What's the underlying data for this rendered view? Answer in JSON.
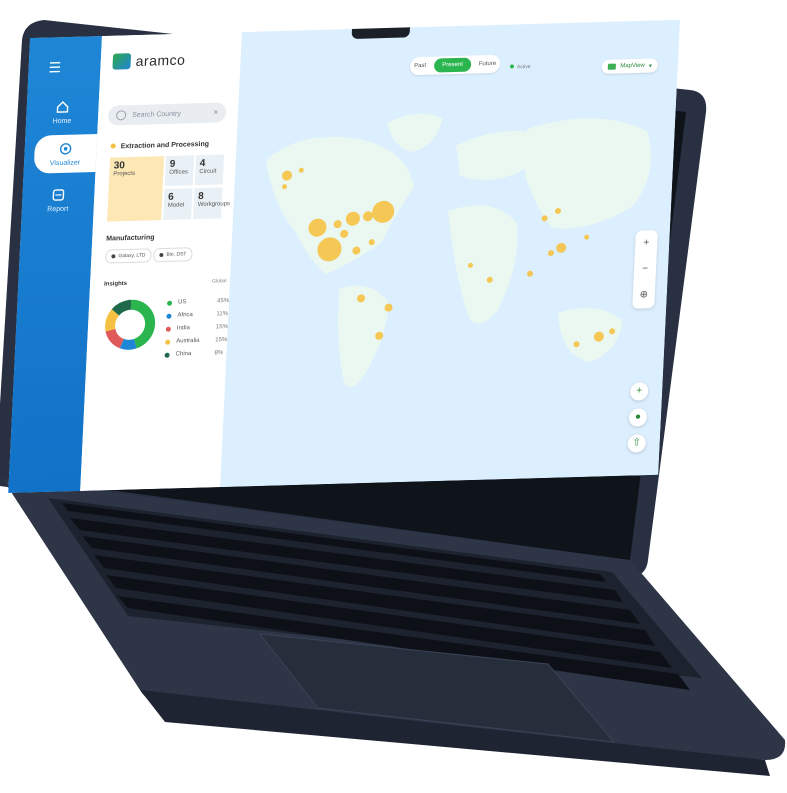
{
  "app": {
    "brand": "aramco",
    "colors": {
      "rail": "#1f86d6",
      "accent_green": "#2bb54f",
      "marker_yellow": "#f6c142",
      "map_land": "#eaf8f1",
      "map_sea": "#dcefff"
    }
  },
  "rail": {
    "menu_icon": "hamburger-icon",
    "items": [
      {
        "label": "Home",
        "icon": "home-icon"
      },
      {
        "label": "Visualizer",
        "icon": "visualizer-icon",
        "active": true
      },
      {
        "label": "Report",
        "icon": "report-icon"
      }
    ]
  },
  "panel": {
    "search": {
      "placeholder": "Search Country",
      "icon": "search-icon",
      "clear": "×"
    },
    "extraction": {
      "title": "Extraction and Processing",
      "tiles": [
        {
          "value": "30",
          "label": "Projects"
        },
        {
          "value": "9",
          "label": "Offices"
        },
        {
          "value": "4",
          "label": "Circuit"
        },
        {
          "value": "6",
          "label": "Model"
        },
        {
          "value": "8",
          "label": "Workgroups"
        }
      ]
    },
    "manufacturing": {
      "title": "Manufacturing",
      "chips": [
        "Galaxy, LTD",
        "Bio, DST"
      ]
    },
    "insights": {
      "title": "Insights",
      "header_right": "Global",
      "legend": [
        {
          "label": "US",
          "pct": "45%",
          "color": "#2bb54f"
        },
        {
          "label": "Africa",
          "pct": "11%",
          "color": "#1f86d6"
        },
        {
          "label": "India",
          "pct": "15%",
          "color": "#e05a5a"
        },
        {
          "label": "Australia",
          "pct": "15%",
          "color": "#f6c142"
        },
        {
          "label": "China",
          "pct": "8%",
          "color": "#1e6a4a"
        }
      ]
    }
  },
  "map": {
    "toggle": {
      "options": [
        "Past",
        "Present",
        "Future"
      ],
      "selected": "Present"
    },
    "live_label": "Active",
    "map_type": "MapView",
    "zoom": {
      "in": "+",
      "out": "−",
      "globe": "⊕"
    },
    "fabs": [
      "+",
      "●",
      "⇧"
    ]
  }
}
